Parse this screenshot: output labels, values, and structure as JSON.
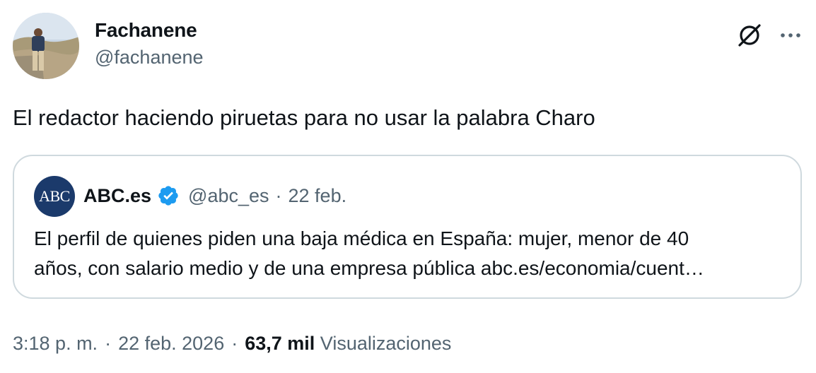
{
  "author": {
    "name": "Fachanene",
    "handle": "@fachanene"
  },
  "icons": {
    "grok": "grok-slash-circle-icon",
    "more": "more-horizontal-icon"
  },
  "tweet": {
    "text": "El redactor haciendo piruetas para no usar la palabra Charo"
  },
  "quote": {
    "avatar_text": "ABC",
    "avatar_color": "#1b3a6b",
    "name": "ABC.es",
    "verified_color": "#1d9bf0",
    "handle": "@abc_es",
    "separator": "·",
    "date": "22 feb.",
    "line1": "El perfil de quienes piden una baja médica en España: mujer, menor de 40",
    "line2": "años, con salario medio y de una empresa pública abc.es/economia/cuent…"
  },
  "meta": {
    "time": "3:18 p. m.",
    "separator": "·",
    "date": "22 feb. 2026",
    "views_count": "63,7 mil",
    "views_label": "Visualizaciones"
  },
  "colors": {
    "text_primary": "#0f1419",
    "text_secondary": "#536471",
    "border": "#cfd9de"
  }
}
